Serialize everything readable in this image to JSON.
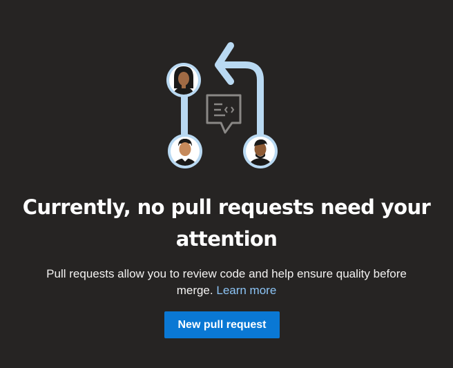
{
  "empty_state": {
    "heading": "Currently, no pull requests need your attention",
    "description": "Pull requests allow you to review code and help ensure quality before merge.",
    "learn_more_label": "Learn more",
    "primary_button_label": "New pull request",
    "illustration_icon": "pull-request-review-illustration"
  },
  "colors": {
    "background": "#262423",
    "accent": "#0a78d4",
    "link": "#8cc4f5",
    "illustration_line": "#b9d9f2"
  }
}
